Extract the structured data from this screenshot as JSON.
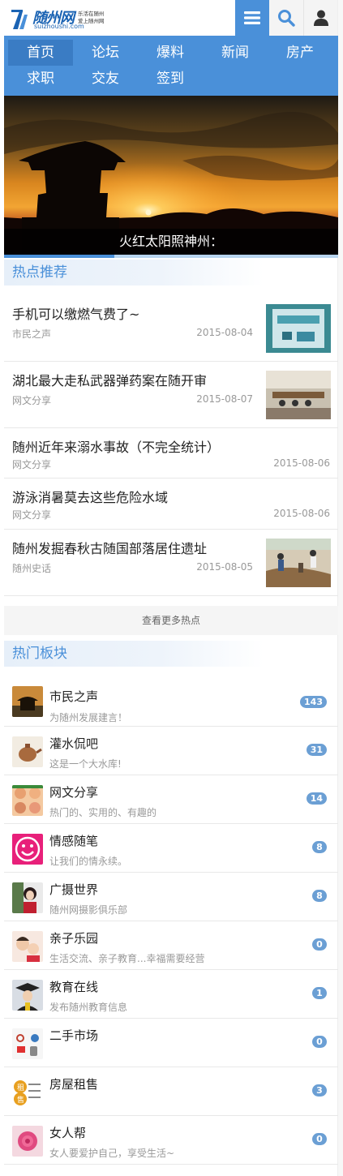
{
  "header": {
    "logo_title": "随州网",
    "logo_domain": "suizhoushi.com",
    "logo_slogan_1": "乐活在随州",
    "logo_slogan_2": "爱上随州网",
    "menu_icon": "menu-icon",
    "search_icon": "search-icon",
    "user_icon": "user-icon"
  },
  "nav": {
    "items": [
      "首页",
      "论坛",
      "爆料",
      "新闻",
      "房产",
      "求职",
      "交友",
      "签到"
    ],
    "active": "首页"
  },
  "banner": {
    "caption": "火红太阳照神州：",
    "slide_progress": 0.33
  },
  "hot": {
    "title": "热点推荐",
    "items": [
      {
        "title": "手机可以缴燃气费了~",
        "category": "市民之声",
        "date": "2015-08-04"
      },
      {
        "title": "湖北最大走私武器弹药案在随开审",
        "category": "网文分享",
        "date": "2015-08-07"
      },
      {
        "title": "随州近年来溺水事故（不完全统计）",
        "category": "网文分享",
        "date": "2015-08-06"
      },
      {
        "title": "游泳消暑莫去这些危险水域",
        "category": "网文分享",
        "date": "2015-08-06"
      },
      {
        "title": "随州发掘春秋古随国部落居住遗址",
        "category": "随州史话",
        "date": "2015-08-05"
      }
    ],
    "more": "查看更多热点"
  },
  "forums": {
    "title": "热门板块",
    "items": [
      {
        "name": "市民之声",
        "desc": "为随州发展建言！",
        "count": "143"
      },
      {
        "name": "灌水侃吧",
        "desc": "这是一个大水库!",
        "count": "31"
      },
      {
        "name": "网文分享",
        "desc": "热门的、实用的、有趣的",
        "count": "14"
      },
      {
        "name": "情感随笔",
        "desc": "让我们的情永续。",
        "count": "8"
      },
      {
        "name": "广摄世界",
        "desc": "随州网摄影俱乐部",
        "count": "8"
      },
      {
        "name": "亲子乐园",
        "desc": "生活交流、亲子教育...幸福需要经营",
        "count": "0"
      },
      {
        "name": "教育在线",
        "desc": "发布随州教育信息",
        "count": "1"
      },
      {
        "name": "二手市场",
        "desc": "",
        "count": "0"
      },
      {
        "name": "房屋租售",
        "desc": "",
        "count": "3"
      },
      {
        "name": "女人帮",
        "desc": "女人要爱护自己，享受生活~",
        "count": "0"
      }
    ]
  },
  "colors": {
    "accent": "#4a90d9",
    "nav_active": "#3a7cc4",
    "badge": "#6b9fd4"
  }
}
